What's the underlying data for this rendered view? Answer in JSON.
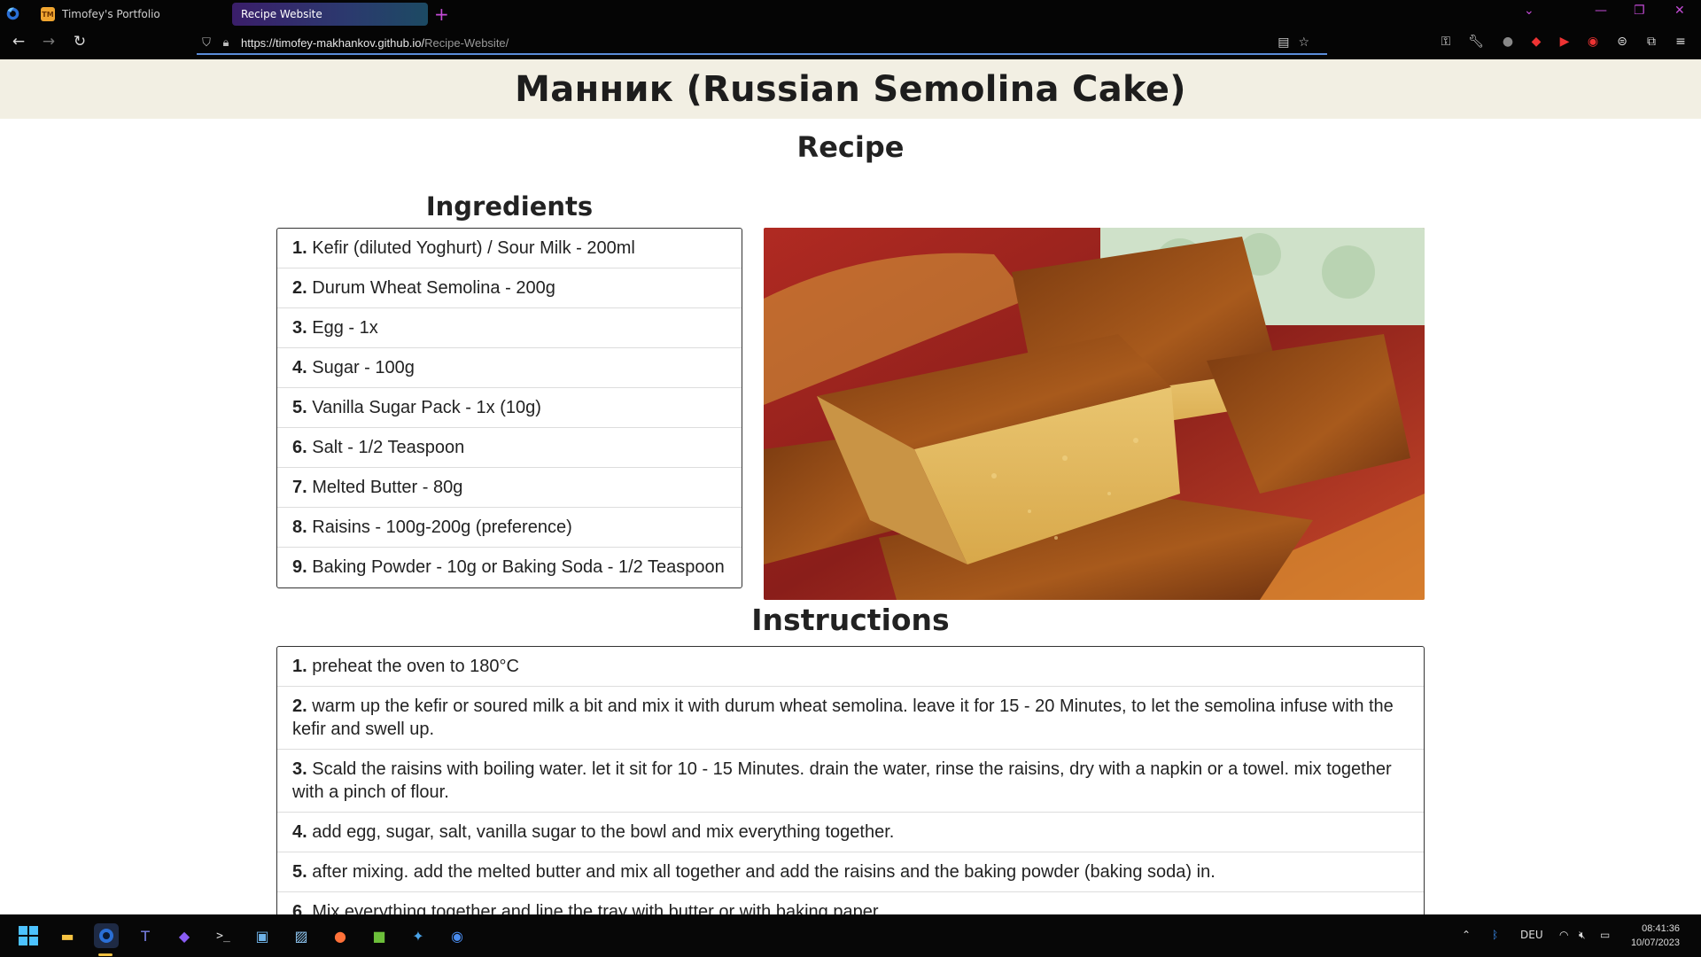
{
  "browser": {
    "tabs": [
      {
        "label": "Timofey's Portfolio",
        "favicon_text": "TM"
      },
      {
        "label": "Recipe Website"
      }
    ],
    "new_tab_label": "+",
    "url_prefix": "https://timofey-makhankov.github.io/",
    "url_path": "Recipe-Website/",
    "accent_color": "#c44bd6"
  },
  "page": {
    "title": "Манник (Russian Semolina Cake)",
    "recipe_heading": "Recipe",
    "ingredients_heading": "Ingredients",
    "ingredients": [
      {
        "num": "1.",
        "text": "Kefir (diluted Yoghurt) / Sour Milk - 200ml"
      },
      {
        "num": "2.",
        "text": "Durum Wheat Semolina - 200g"
      },
      {
        "num": "3.",
        "text": "Egg - 1x"
      },
      {
        "num": "4.",
        "text": "Sugar - 100g"
      },
      {
        "num": "5.",
        "text": "Vanilla Sugar Pack - 1x (10g)"
      },
      {
        "num": "6.",
        "text": "Salt - 1/2 Teaspoon"
      },
      {
        "num": "7.",
        "text": "Melted Butter - 80g"
      },
      {
        "num": "8.",
        "text": "Raisins - 100g-200g (preference)"
      },
      {
        "num": "9.",
        "text": "Baking Powder - 10g or Baking Soda - 1/2 Teaspoon"
      }
    ],
    "instructions_heading": "Instructions",
    "instructions": [
      {
        "num": "1.",
        "text": "preheat the oven to 180°C"
      },
      {
        "num": "2.",
        "text": "warm up the kefir or soured milk a bit and mix it with durum wheat semolina. leave it for 15 - 20 Minutes, to let the semolina infuse with the kefir and swell up."
      },
      {
        "num": "3.",
        "text": "Scald the raisins with boiling water. let it sit for 10 - 15 Minutes. drain the water, rinse the raisins, dry with a napkin or a towel. mix together with a pinch of flour."
      },
      {
        "num": "4.",
        "text": "add egg, sugar, salt, vanilla sugar to the bowl and mix everything together."
      },
      {
        "num": "5.",
        "text": "after mixing. add the melted butter and mix all together and add the raisins and the baking powder (baking soda) in."
      },
      {
        "num": "6.",
        "text": "Mix everything together and line the tray with butter or with baking paper"
      }
    ]
  },
  "taskbar": {
    "language": "DEU",
    "time": "08:41:36",
    "date": "10/07/2023",
    "icons": [
      "start-icon",
      "file-explorer-icon",
      "firefox-dev-icon",
      "teams-icon",
      "obsidian-icon",
      "terminal-icon",
      "control-panel-icon",
      "resource-monitor-icon",
      "firefox-icon",
      "minecraft-icon",
      "vscode-icon",
      "browser-icon"
    ]
  }
}
